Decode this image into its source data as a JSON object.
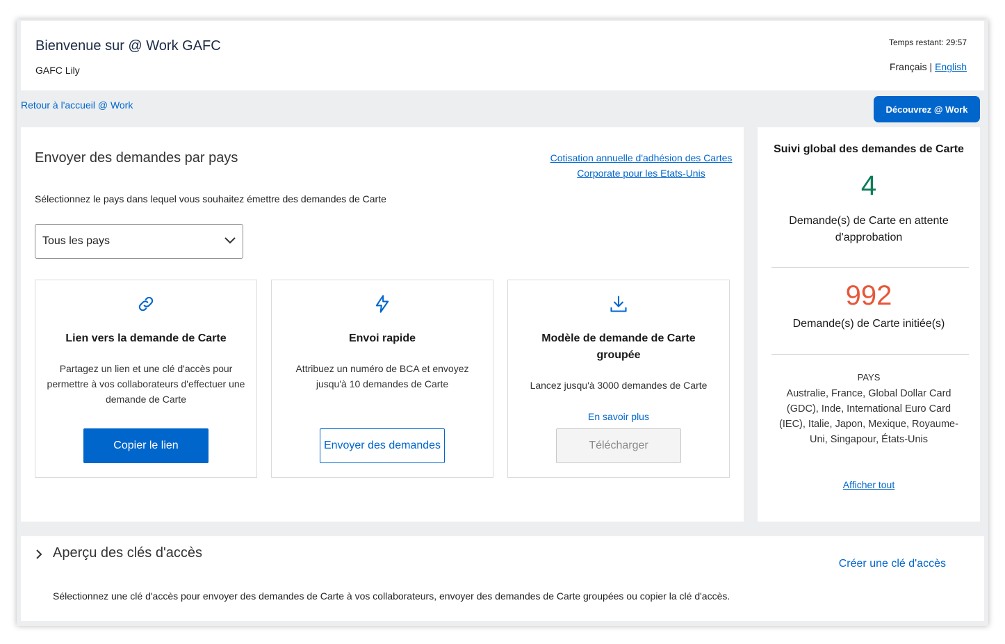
{
  "header": {
    "welcome": "Bienvenue sur @ Work GAFC",
    "user": "GAFC Lily",
    "timer": "Temps restant: 29:57",
    "lang_fr": "Français",
    "lang_sep": "|",
    "lang_en": "English"
  },
  "nav": {
    "back": "Retour à l'accueil @ Work",
    "discover": "Découvrez @ Work"
  },
  "main": {
    "title": "Envoyer des demandes par pays",
    "cotisation_link": "Cotisation annuelle d'adhésion des Cartes Corporate pour les Etats-Unis",
    "select_label": "Sélectionnez le pays dans lequel vous souhaitez émettre des demandes de Carte",
    "select_value": "Tous les pays",
    "cards": [
      {
        "icon": "link-icon",
        "title": "Lien vers la demande de Carte",
        "desc": "Partagez un lien et une clé d'accès pour permettre à vos collaborateurs d'effectuer une demande de Carte",
        "button": "Copier le lien"
      },
      {
        "icon": "lightning-icon",
        "title": "Envoi rapide",
        "desc": "Attribuez un numéro de BCA et envoyez jusqu'à 10 demandes de Carte",
        "button": "Envoyer des demandes"
      },
      {
        "icon": "download-icon",
        "title": "Modèle de demande de Carte groupée",
        "desc": "Lancez jusqu'à 3000 demandes de Carte",
        "link": "En savoir plus",
        "button": "Télécharger"
      }
    ]
  },
  "side": {
    "title": "Suivi global des demandes de Carte",
    "pending_count": "4",
    "pending_label": "Demande(s) de Carte en attente d'approbation",
    "initiated_count": "992",
    "initiated_label": "Demande(s) de Carte initiée(s)",
    "pays_heading": "PAYS",
    "pays_list": "Australie, France, Global Dollar Card (GDC), Inde, International Euro Card (IEC), Italie, Japon, Mexique, Royaume-Uni, Singapour, États-Unis",
    "show_all": "Afficher tout"
  },
  "bottom": {
    "title": "Aperçu des clés d'accès",
    "create_key": "Créer une clé d'accès",
    "desc": "Sélectionnez une clé d'accès pour envoyer des demandes de Carte à vos collaborateurs, envoyer des demandes de Carte groupées ou copier la clé d'accès."
  },
  "colors": {
    "accent": "#0066cc",
    "pending": "#0e7c5a",
    "initiated": "#e6573a"
  }
}
